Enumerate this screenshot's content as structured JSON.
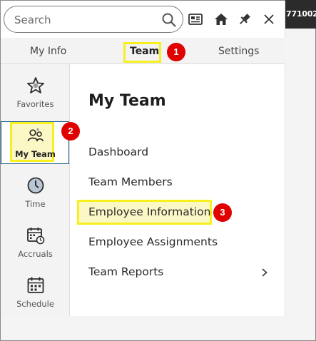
{
  "window": {
    "id_fragment": "771002"
  },
  "search": {
    "placeholder": "Search"
  },
  "header_icons": {
    "view": "view-icon",
    "home": "home-icon",
    "pin": "pin-icon",
    "close": "close-icon"
  },
  "tabs": [
    {
      "label": "My Info"
    },
    {
      "label": "Team"
    },
    {
      "label": "Settings"
    }
  ],
  "rail": {
    "items": [
      {
        "label": "Favorites",
        "icon": "star-icon"
      },
      {
        "label": "My Team",
        "icon": "team-icon"
      },
      {
        "label": "Time",
        "icon": "clock-icon"
      },
      {
        "label": "Accruals",
        "icon": "calendar-clock-icon"
      },
      {
        "label": "Schedule",
        "icon": "calendar-icon"
      }
    ]
  },
  "main": {
    "title": "My Team",
    "items": [
      {
        "label": "Dashboard"
      },
      {
        "label": "Team Members"
      },
      {
        "label": "Employee Information"
      },
      {
        "label": "Employee Assignments"
      },
      {
        "label": "Team Reports"
      }
    ]
  },
  "annotations": {
    "step1": "1",
    "step2": "2",
    "step3": "3"
  },
  "colors": {
    "highlight": "#f6f01e",
    "badge": "#e00000",
    "active_border": "#1b5a8a"
  }
}
